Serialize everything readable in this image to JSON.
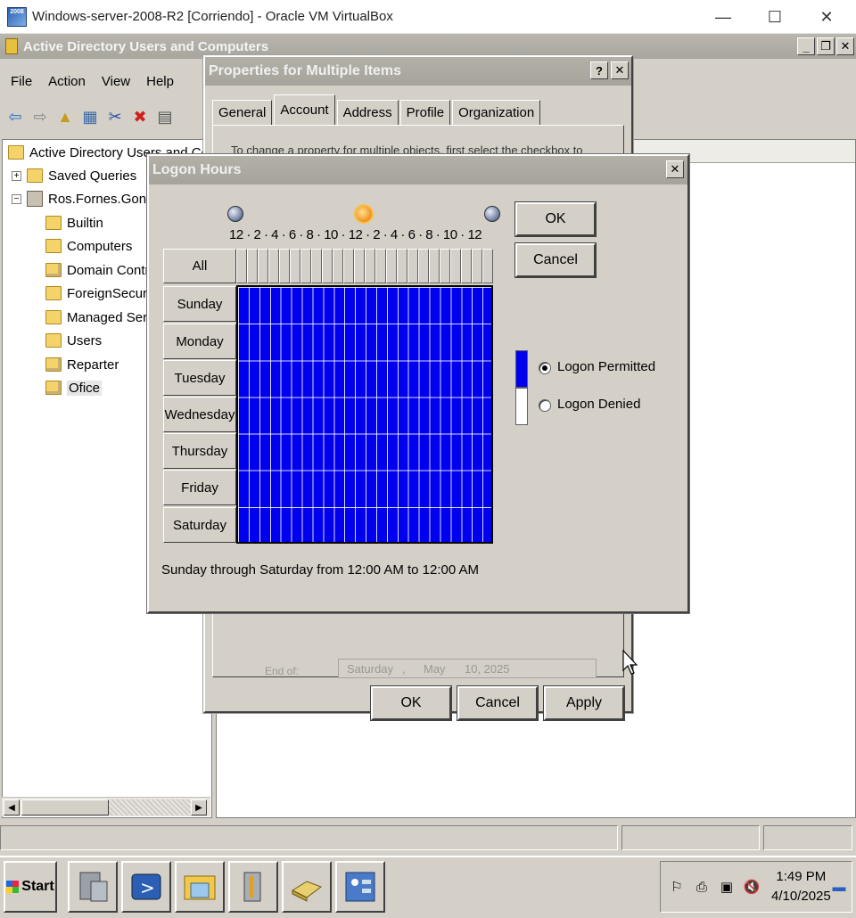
{
  "host_window": {
    "title": "Windows-server-2008-R2 [Corriendo] - Oracle VM VirtualBox",
    "icon_text": "2008",
    "minimize": "—",
    "maximize": "☐",
    "close": "✕"
  },
  "mmc": {
    "title": "Active Directory Users and Computers",
    "menu": [
      "File",
      "Action",
      "View",
      "Help"
    ],
    "tree": {
      "root": "Active Directory Users and Compu",
      "saved_queries": "Saved Queries",
      "domain": "Ros.Fornes.Gonzal",
      "children": [
        "Builtin",
        "Computers",
        "Domain Control",
        "ForeignSecurity",
        "Managed Servic",
        "Users",
        "Reparter",
        "Ofice"
      ],
      "selected": "Ofice"
    }
  },
  "properties_dialog": {
    "title": "Properties for Multiple Items",
    "help_btn": "?",
    "close_btn": "✕",
    "tabs": [
      "General",
      "Account",
      "Address",
      "Profile",
      "Organization"
    ],
    "active_tab": "Account",
    "buttons": {
      "ok": "OK",
      "cancel": "Cancel",
      "apply": "Apply"
    },
    "partial_text": "To change a property for multiple objects, first select the checkbox to",
    "end_of_label": "End of:",
    "date_parts": [
      "Saturday",
      ",",
      "May",
      "10, 2025"
    ]
  },
  "logon_hours": {
    "title": "Logon Hours",
    "close_btn": "✕",
    "hour_labels": "12 · 2 · 4 · 6 · 8 · 10 · 12 · 2 · 4 · 6 · 8 · 10 · 12",
    "all_label": "All",
    "days": [
      "Sunday",
      "Monday",
      "Tuesday",
      "Wednesday",
      "Thursday",
      "Friday",
      "Saturday"
    ],
    "hours_per_day": 24,
    "permitted_color": "#0000ee",
    "denied_color": "#ffffff",
    "ok": "OK",
    "cancel": "Cancel",
    "legend_permitted": "Logon Permitted",
    "legend_denied": "Logon Denied",
    "selected_option": "Logon Permitted",
    "summary": "Sunday through Saturday from 12:00 AM to 12:00 AM"
  },
  "taskbar": {
    "start": "Start",
    "apps": [
      "server-manager-icon",
      "powershell-icon",
      "explorer-icon",
      "ad-tools-icon",
      "storage-icon",
      "control-panel-icon"
    ],
    "clock_time": "1:49 PM",
    "clock_date": "4/10/2025"
  }
}
